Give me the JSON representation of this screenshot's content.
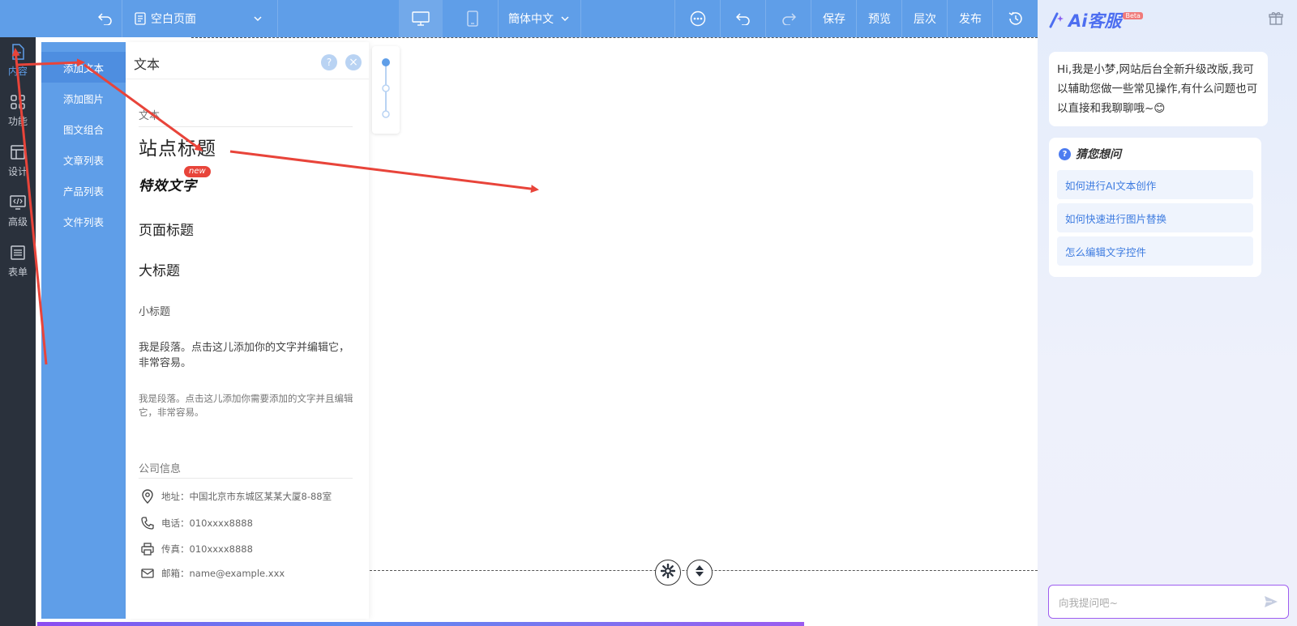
{
  "toolbar": {
    "undo_icon": "undo-icon",
    "page_name": "空白页面",
    "language": "簡体中文",
    "save": "保存",
    "preview": "预览",
    "layers": "层次",
    "publish": "发布"
  },
  "rail": {
    "items": [
      {
        "label": "内容",
        "icon": "document-icon"
      },
      {
        "label": "功能",
        "icon": "grid-icon"
      },
      {
        "label": "设计",
        "icon": "layout-icon"
      },
      {
        "label": "高级",
        "icon": "code-icon"
      },
      {
        "label": "表单",
        "icon": "list-icon"
      }
    ]
  },
  "categories": [
    {
      "label": "添加文本"
    },
    {
      "label": "添加图片"
    },
    {
      "label": "图文组合"
    },
    {
      "label": "文章列表"
    },
    {
      "label": "产品列表"
    },
    {
      "label": "文件列表"
    }
  ],
  "text_panel": {
    "title": "文本",
    "help": "?",
    "close": "×",
    "section_text": "文本",
    "site_title": "站点标题",
    "effect_text": "特效文字",
    "new_badge": "new",
    "page_title": "页面标题",
    "big_title": "大标题",
    "small_title": "小标题",
    "paragraph": "我是段落。点击这儿添加你的文字并编辑它，非常容易。",
    "paragraph_small": "我是段落。点击这儿添加你需要添加的文字并且编辑它，非常容易。",
    "section_company": "公司信息",
    "address": "地址：中国北京市东城区某某大厦8-88室",
    "phone": "电话：010xxxx8888",
    "fax": "传真：010xxxx8888",
    "email": "邮箱：name@example.xxx"
  },
  "ai": {
    "logo": "Ai客服",
    "beta": "Beta",
    "greeting": "Hi,我是小梦,网站后台全新升级改版,我可以辅助您做一些常见操作,有什么问题也可以直接和我聊聊哦~😊",
    "guess_title": "猜您想问",
    "questions": [
      "如何进行AI文本创作",
      "如何快速进行图片替换",
      "怎么编辑文字控件"
    ],
    "input_placeholder": "向我提问吧~"
  },
  "colors": {
    "toolbar": "#5f9ee8",
    "rail": "#2a313c",
    "accent": "#4d7cf0",
    "arrow": "#e8443a"
  }
}
